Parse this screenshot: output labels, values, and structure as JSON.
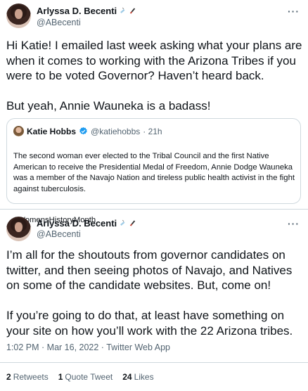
{
  "tweet1": {
    "display_name": "Arlyssa D. Becenti",
    "handle": "@ABecenti",
    "more": "···",
    "text": "Hi Katie! I emailed last week asking what your plans are when it comes to working with the Arizona Tribes if you were to be voted Governor?  Haven’t heard back.\n\nBut yeah, Annie Wauneka is a badass!"
  },
  "quote": {
    "display_name": "Katie Hobbs",
    "handle": "@katiehobbs",
    "time": "· 21h",
    "text": "The second woman ever elected to the Tribal Council and the first Native American to receive the Presidential Medal of Freedom, Annie Dodge Wauneka was a member of the Navajo Nation and tireless public health activist in the fight against tuberculosis.",
    "hashtag": "#WomensHistoryMonth"
  },
  "tweet2": {
    "display_name": "Arlyssa D. Becenti",
    "handle": "@ABecenti",
    "more": "···",
    "text": "I’m all for the shoutouts from governor candidates on twitter, and then seeing photos of Navajo, and Natives on some of the candidate websites. But, come on!\n\nIf you’re going to do that, at least have something on your site on how you’ll work with the 22 Arizona tribes.",
    "timestamp": "1:02 PM · Mar 16, 2022 · Twitter Web App",
    "stats": {
      "retweets_count": "2",
      "retweets_label": "Retweets",
      "quotes_count": "1",
      "quotes_label": "Quote Tweet",
      "likes_count": "24",
      "likes_label": "Likes"
    }
  },
  "colors": {
    "text": "#0f1419",
    "muted": "#536471",
    "border": "#cfd9de",
    "verified": "#1d9bf0"
  },
  "icons": [
    "syringe-emoji",
    "paintbrush-emoji",
    "verified-badge-icon",
    "sparkles-emoji",
    "more-options-icon"
  ]
}
